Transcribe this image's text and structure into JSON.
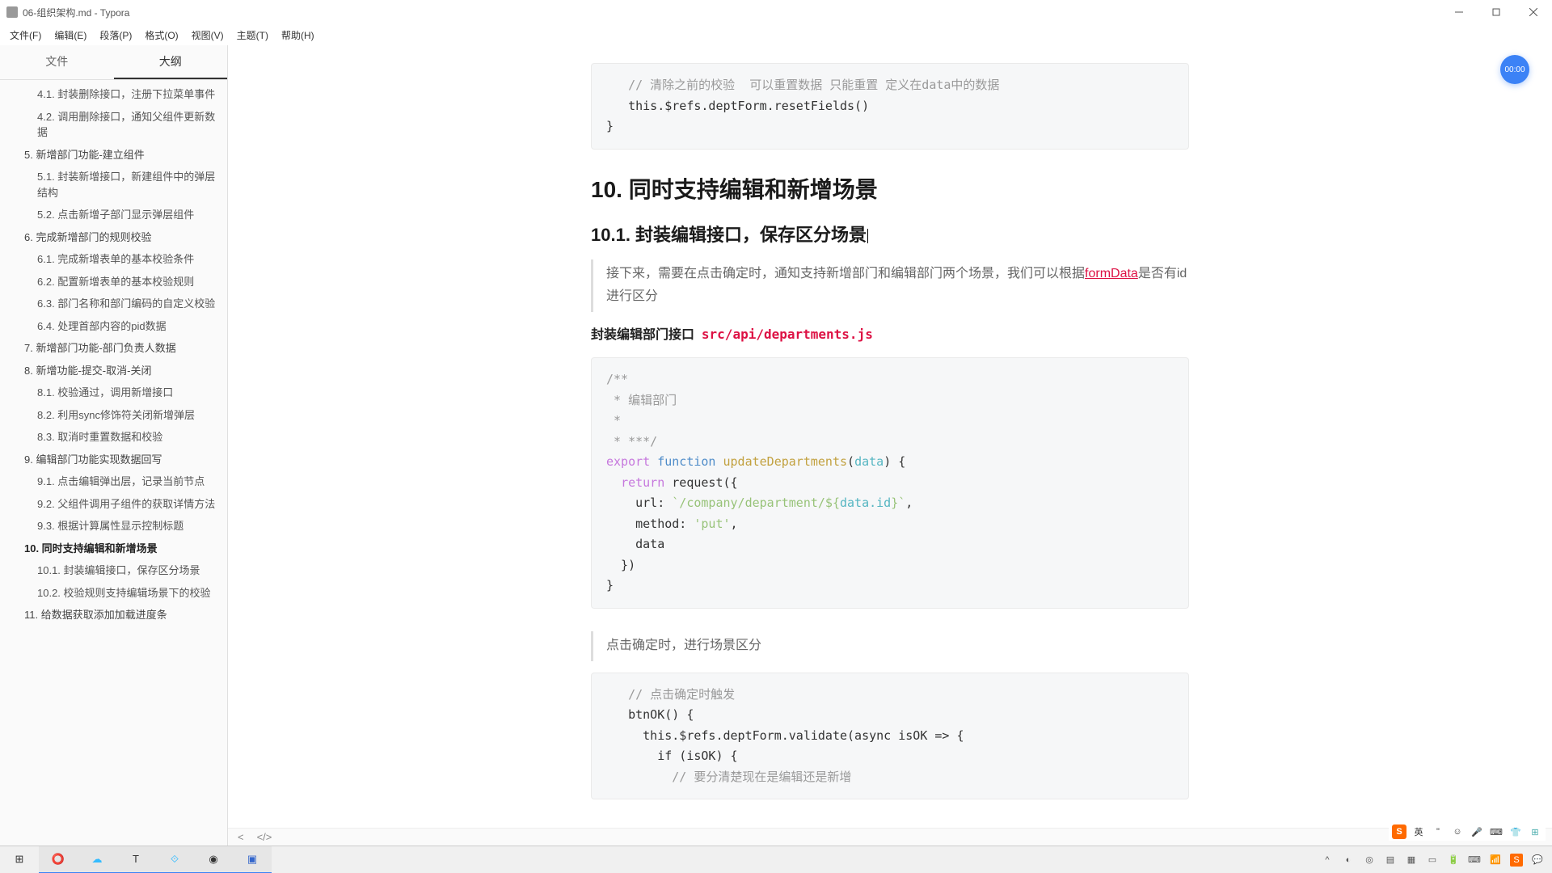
{
  "window": {
    "title": "06-组织架构.md - Typora"
  },
  "menu": {
    "file": "文件(F)",
    "edit": "编辑(E)",
    "paragraph": "段落(P)",
    "format": "格式(O)",
    "view": "视图(V)",
    "theme": "主题(T)",
    "help": "帮助(H)"
  },
  "sidebar": {
    "tab_file": "文件",
    "tab_outline": "大纲",
    "items": [
      {
        "text": "4.1. 封装删除接口，注册下拉菜单事件",
        "level": 2
      },
      {
        "text": "4.2. 调用删除接口，通知父组件更新数据",
        "level": 2
      },
      {
        "text": "5. 新增部门功能-建立组件",
        "level": 1
      },
      {
        "text": "5.1. 封装新增接口，新建组件中的弹层结构",
        "level": 2
      },
      {
        "text": "5.2. 点击新增子部门显示弹层组件",
        "level": 2
      },
      {
        "text": "6. 完成新增部门的规则校验",
        "level": 1
      },
      {
        "text": "6.1. 完成新增表单的基本校验条件",
        "level": 2
      },
      {
        "text": "6.2. 配置新增表单的基本校验规则",
        "level": 2
      },
      {
        "text": "6.3. 部门名称和部门编码的自定义校验",
        "level": 2
      },
      {
        "text": "6.4. 处理首部内容的pid数据",
        "level": 2
      },
      {
        "text": "7. 新增部门功能-部门负责人数据",
        "level": 1
      },
      {
        "text": "8. 新增功能-提交-取消-关闭",
        "level": 1
      },
      {
        "text": "8.1. 校验通过，调用新增接口",
        "level": 2
      },
      {
        "text": "8.2. 利用sync修饰符关闭新增弹层",
        "level": 2
      },
      {
        "text": "8.3. 取消时重置数据和校验",
        "level": 2
      },
      {
        "text": "9. 编辑部门功能实现数据回写",
        "level": 1
      },
      {
        "text": "9.1. 点击编辑弹出层，记录当前节点",
        "level": 2
      },
      {
        "text": "9.2. 父组件调用子组件的获取详情方法",
        "level": 2
      },
      {
        "text": "9.3. 根据计算属性显示控制标题",
        "level": 2
      },
      {
        "text": "10. 同时支持编辑和新增场景",
        "level": 1,
        "active": true
      },
      {
        "text": "10.1. 封装编辑接口，保存区分场景",
        "level": 2
      },
      {
        "text": "10.2. 校验规则支持编辑场景下的校验",
        "level": 2
      },
      {
        "text": "11. 给数据获取添加加载进度条",
        "level": 1
      }
    ]
  },
  "timer": "00:00",
  "content": {
    "code0_comment": "// 清除之前的校验  可以重置数据 只能重置 定义在data中的数据",
    "code0_line": "this.$refs.deptForm.resetFields()",
    "code0_brace": "}",
    "h10": "10. 同时支持编辑和新增场景",
    "h101": "10.1. 封装编辑接口，保存区分场景",
    "quote_pre": "接下来，需要在点击确定时，通知支持新增部门和编辑部门两个场景，我们可以根据",
    "quote_link": "formData",
    "quote_post": "是否有id进行区分",
    "para_label": "封装编辑部门接口",
    "para_path": "src/api/departments.js",
    "code1": "/**\n * 编辑部门\n *\n * ***/\nexport function updateDepartments(data) {\n  return request({\n    url: `/company/department/${data.id}`,\n    method: 'put',\n    data\n  })\n}",
    "quote2": "点击确定时，进行场景区分",
    "code2_c1": "// 点击确定时触发",
    "code2_l1": "btnOK() {",
    "code2_l2": "  this.$refs.deptForm.validate(async isOK => {",
    "code2_l3": "    if (isOK) {",
    "code2_c2": "      // 要分清楚现在是编辑还是新增"
  },
  "footer": {
    "back": "<",
    "code": "</>"
  }
}
